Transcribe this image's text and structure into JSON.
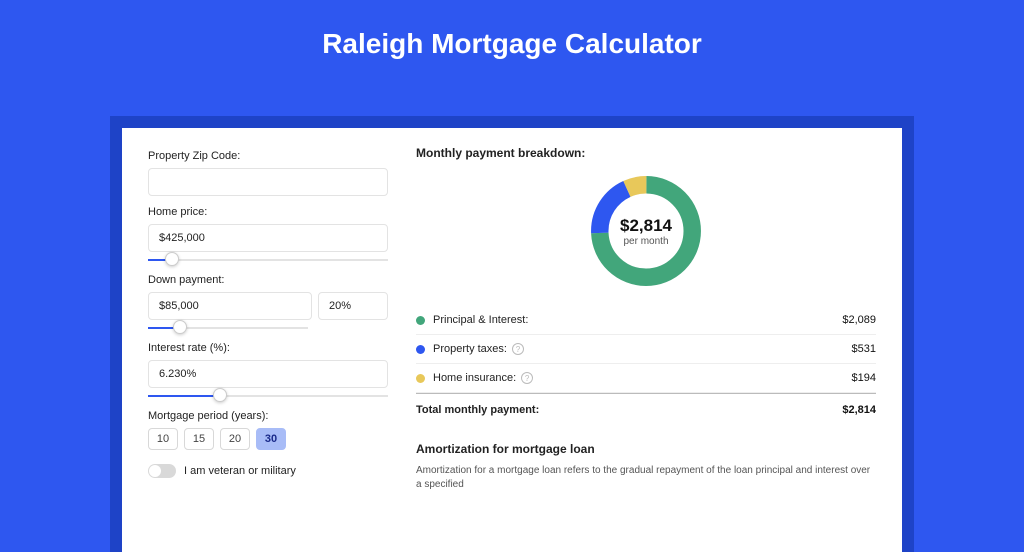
{
  "page_title": "Raleigh Mortgage Calculator",
  "left_panel": {
    "zip_label": "Property Zip Code:",
    "zip_value": "",
    "home_price_label": "Home price:",
    "home_price_value": "$425,000",
    "home_price_slider_pct": 10,
    "down_payment_label": "Down payment:",
    "down_payment_value": "$85,000",
    "down_payment_pct_value": "20%",
    "down_payment_slider_pct": 20,
    "interest_label": "Interest rate (%):",
    "interest_value": "6.230%",
    "interest_slider_pct": 30,
    "period_label": "Mortgage period (years):",
    "periods": [
      "10",
      "15",
      "20",
      "30"
    ],
    "period_active_index": 3,
    "veteran_label": "I am veteran or military"
  },
  "right_panel": {
    "breakdown_title": "Monthly payment breakdown:",
    "donut_total": "$2,814",
    "donut_sub": "per month",
    "items": [
      {
        "label": "Principal & Interest:",
        "value": "$2,089",
        "color": "green",
        "info": false
      },
      {
        "label": "Property taxes:",
        "value": "$531",
        "color": "blue",
        "info": true
      },
      {
        "label": "Home insurance:",
        "value": "$194",
        "color": "yellow",
        "info": true
      }
    ],
    "total_label": "Total monthly payment:",
    "total_value": "$2,814",
    "amort_title": "Amortization for mortgage loan",
    "amort_text": "Amortization for a mortgage loan refers to the gradual repayment of the loan principal and interest over a specified"
  },
  "chart_data": {
    "type": "pie",
    "title": "Monthly payment breakdown",
    "series": [
      {
        "name": "Principal & Interest",
        "value": 2089,
        "color": "#42a67b"
      },
      {
        "name": "Property taxes",
        "value": 531,
        "color": "#2e57f0"
      },
      {
        "name": "Home insurance",
        "value": 194,
        "color": "#e8c85a"
      }
    ],
    "total": 2814,
    "center_label": "$2,814 per month"
  }
}
